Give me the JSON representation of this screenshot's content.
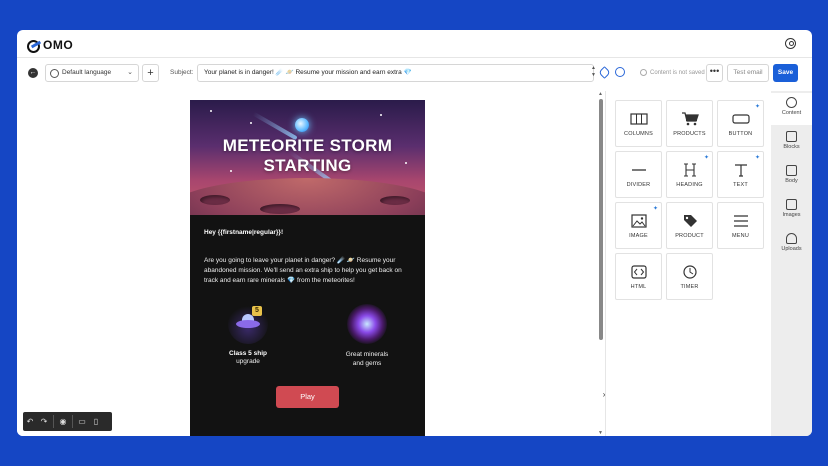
{
  "app": {
    "logo_text": "OMO"
  },
  "toolbar": {
    "language": "Default language",
    "subject_label": "Subject:",
    "subject_text": "Your planet is in danger! ☄️ 🪐 Resume your mission and earn extra ",
    "subject_gem": "💎",
    "saved_status": "Content is not saved",
    "more": "•••",
    "test_email": "Test email",
    "save": "Save"
  },
  "email": {
    "hero_title_line1": "METEORITE STORM",
    "hero_title_line2": "STARTING",
    "greeting": "Hey {{firstname|regular}}!",
    "body_part1": "Are you going to leave your planet in danger? ☄️ 🪐 Resume your abandoned mission. We'll send an extra ship to help you get back on track and earn rare minerals ",
    "body_gem": "💎",
    "body_part2": " from the meteorites!",
    "feature1_bold": "Class 5 ship",
    "feature1_sub": "upgrade",
    "feature1_badge": "5",
    "feature2_line1": "Great minerals",
    "feature2_line2": "and gems",
    "play": "Play"
  },
  "blocks": [
    {
      "label": "COLUMNS",
      "icon": "columns-icon",
      "ai": false
    },
    {
      "label": "PRODUCTS",
      "icon": "cart-icon",
      "ai": false
    },
    {
      "label": "BUTTON",
      "icon": "button-icon",
      "ai": true
    },
    {
      "label": "DIVIDER",
      "icon": "divider-icon",
      "ai": false
    },
    {
      "label": "HEADING",
      "icon": "heading-icon",
      "ai": true
    },
    {
      "label": "TEXT",
      "icon": "text-icon",
      "ai": true
    },
    {
      "label": "IMAGE",
      "icon": "image-icon",
      "ai": true
    },
    {
      "label": "PRODUCT",
      "icon": "tag-icon",
      "ai": false
    },
    {
      "label": "MENU",
      "icon": "menu-icon",
      "ai": false
    },
    {
      "label": "HTML",
      "icon": "code-icon",
      "ai": false
    },
    {
      "label": "TIMER",
      "icon": "clock-icon",
      "ai": false
    }
  ],
  "sidetabs": [
    {
      "label": "Content",
      "icon": "shapes-icon",
      "active": true
    },
    {
      "label": "Blocks",
      "icon": "grid-icon",
      "active": false
    },
    {
      "label": "Body",
      "icon": "layout-icon",
      "active": false
    },
    {
      "label": "Images",
      "icon": "images-icon",
      "active": false
    },
    {
      "label": "Uploads",
      "icon": "upload-cloud-icon",
      "active": false
    }
  ],
  "bottom_bar": {
    "undo": "↶",
    "redo": "↷",
    "preview": "◉",
    "desktop": "▭",
    "mobile": "▯"
  },
  "colors": {
    "background": "#1546c4",
    "accent": "#1a5fd8",
    "play_button": "#d04a52",
    "email_bg": "#121212"
  }
}
